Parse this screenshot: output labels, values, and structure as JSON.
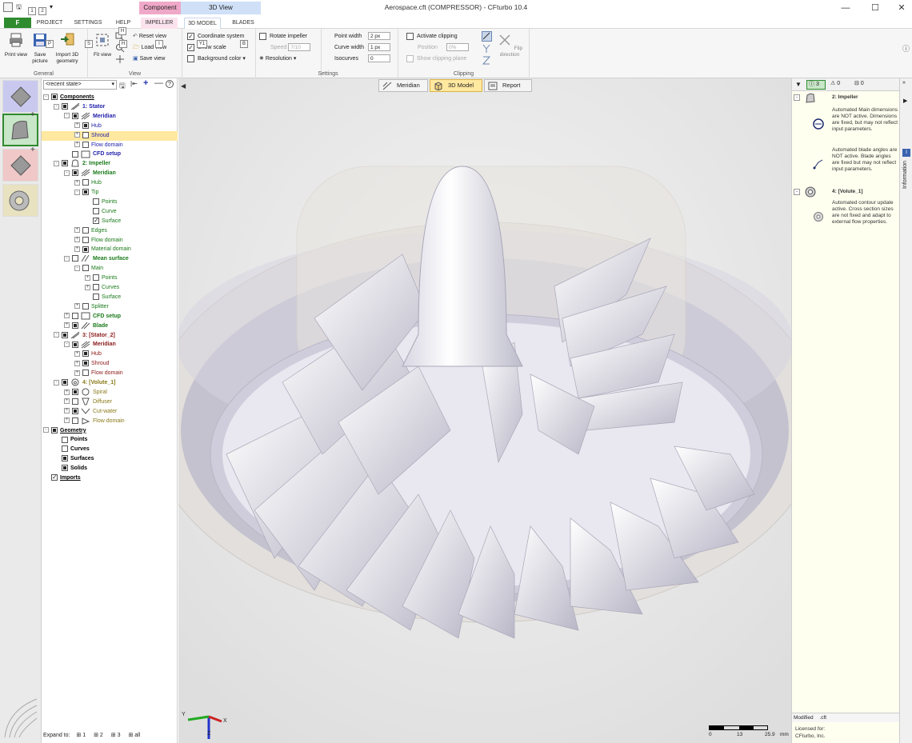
{
  "window": {
    "title": "Aerospace.cft (COMPRESSOR) - CFturbo 10.4",
    "minimize": "—",
    "maximize": "☐",
    "close": "✕"
  },
  "quick_access_keytips": [
    "1",
    "2"
  ],
  "context_tabs": {
    "component": "Component",
    "view3d": "3D View"
  },
  "tabs": [
    {
      "label": "F",
      "keytip": ""
    },
    {
      "label": "PROJECT",
      "keytip": "P"
    },
    {
      "label": "SETTINGS",
      "keytip": "S"
    },
    {
      "label": "HELP",
      "keytip": "H"
    },
    {
      "label": "IMPELLER",
      "keytip": "I"
    },
    {
      "label": "3D MODEL",
      "keytip": "Y1"
    },
    {
      "label": "BLADES",
      "keytip": "B"
    }
  ],
  "ribbon": {
    "general": {
      "label": "General",
      "print": "Print view",
      "save_picture": "Save picture",
      "import_3d": "Import 3D geometry"
    },
    "view": {
      "label": "View",
      "fit": "Fit view",
      "reset": "Reset view",
      "load": "Load view",
      "save": "Save view"
    },
    "display": {
      "coordinate_system": "Coordinate system",
      "show_scale": "Show scale",
      "background_color": "Background color"
    },
    "settings": {
      "label": "Settings",
      "rotate_impeller": "Rotate impeller",
      "speed_label": "Speed",
      "speed_value": "7/10",
      "resolution": "Resolution",
      "point_width_label": "Point width",
      "point_width_value": "2 px",
      "curve_width_label": "Curve width",
      "curve_width_value": "1 px",
      "isocurves_label": "Isocurves",
      "isocurves_value": "0"
    },
    "clipping": {
      "label": "Clipping",
      "activate": "Activate clipping",
      "position_label": "Position",
      "position_value": "0%",
      "show_plane": "Show clipping plane",
      "flip": "Flip direction"
    }
  },
  "tree": {
    "state_select": "<recent state>",
    "rows": [
      {
        "label": "Components",
        "indent": 0,
        "style": "bold-under",
        "color": "#000000",
        "pm": "-",
        "check": "on"
      },
      {
        "label": "1: Stator",
        "indent": 1,
        "style": "bold",
        "color": "#2222aa",
        "pm": "-",
        "check": "on",
        "icon": "stator"
      },
      {
        "label": "Meridian",
        "indent": 2,
        "style": "bold",
        "color": "#2222aa",
        "pm": "-",
        "check": "on",
        "icon": "meridian"
      },
      {
        "label": "Hub",
        "indent": 3,
        "style": "",
        "color": "#2222aa",
        "pm": "+",
        "check": "on"
      },
      {
        "label": "Shroud",
        "indent": 3,
        "style": "",
        "color": "#2222aa",
        "pm": "+",
        "check": "off",
        "selected": true
      },
      {
        "label": "Flow domain",
        "indent": 3,
        "style": "",
        "color": "#2222aa",
        "pm": "+",
        "check": "off"
      },
      {
        "label": "CFD setup",
        "indent": 2,
        "style": "bold",
        "color": "#2222aa",
        "pm": "",
        "check": "off",
        "icon": "cfd"
      },
      {
        "label": "2: Impeller",
        "indent": 1,
        "style": "bold",
        "color": "#1a7a1a",
        "pm": "-",
        "check": "on",
        "icon": "impeller"
      },
      {
        "label": "Meridian",
        "indent": 2,
        "style": "bold",
        "color": "#1a7a1a",
        "pm": "-",
        "check": "on",
        "icon": "meridian"
      },
      {
        "label": "Hub",
        "indent": 3,
        "style": "",
        "color": "#1a7a1a",
        "pm": "+",
        "check": "off"
      },
      {
        "label": "Tip",
        "indent": 3,
        "style": "",
        "color": "#1a7a1a",
        "pm": "-",
        "check": "on"
      },
      {
        "label": "Points",
        "indent": 4,
        "style": "",
        "color": "#1a7a1a",
        "pm": "",
        "check": "off"
      },
      {
        "label": "Curve",
        "indent": 4,
        "style": "",
        "color": "#1a7a1a",
        "pm": "",
        "check": "off"
      },
      {
        "label": "Surface",
        "indent": 4,
        "style": "",
        "color": "#1a7a1a",
        "pm": "",
        "check": "chk"
      },
      {
        "label": "Edges",
        "indent": 3,
        "style": "",
        "color": "#1a7a1a",
        "pm": "+",
        "check": "off"
      },
      {
        "label": "Flow domain",
        "indent": 3,
        "style": "",
        "color": "#1a7a1a",
        "pm": "+",
        "check": "off"
      },
      {
        "label": "Material domain",
        "indent": 3,
        "style": "",
        "color": "#1a7a1a",
        "pm": "+",
        "check": "on"
      },
      {
        "label": "Mean surface",
        "indent": 2,
        "style": "bold",
        "color": "#1a7a1a",
        "pm": "-",
        "check": "off",
        "icon": "mean"
      },
      {
        "label": "Main",
        "indent": 3,
        "style": "",
        "color": "#1a7a1a",
        "pm": "-",
        "check": "off"
      },
      {
        "label": "Points",
        "indent": 4,
        "style": "",
        "color": "#1a7a1a",
        "pm": "+",
        "check": "off"
      },
      {
        "label": "Curves",
        "indent": 4,
        "style": "",
        "color": "#1a7a1a",
        "pm": "+",
        "check": "off"
      },
      {
        "label": "Surface",
        "indent": 4,
        "style": "",
        "color": "#1a7a1a",
        "pm": "",
        "check": "off"
      },
      {
        "label": "Splitter",
        "indent": 3,
        "style": "",
        "color": "#1a7a1a",
        "pm": "+",
        "check": "off"
      },
      {
        "label": "CFD setup",
        "indent": 2,
        "style": "bold",
        "color": "#1a7a1a",
        "pm": "+",
        "check": "off",
        "icon": "cfd"
      },
      {
        "label": "Blade",
        "indent": 2,
        "style": "bold",
        "color": "#1a7a1a",
        "pm": "+",
        "check": "on",
        "icon": "blade"
      },
      {
        "label": "3: [Stator_2]",
        "indent": 1,
        "style": "bold",
        "color": "#8b1a1a",
        "pm": "-",
        "check": "on",
        "icon": "stator"
      },
      {
        "label": "Meridian",
        "indent": 2,
        "style": "bold",
        "color": "#8b1a1a",
        "pm": "-",
        "check": "on",
        "icon": "meridian"
      },
      {
        "label": "Hub",
        "indent": 3,
        "style": "",
        "color": "#8b1a1a",
        "pm": "+",
        "check": "on"
      },
      {
        "label": "Shroud",
        "indent": 3,
        "style": "",
        "color": "#8b1a1a",
        "pm": "+",
        "check": "on"
      },
      {
        "label": "Flow domain",
        "indent": 3,
        "style": "",
        "color": "#8b1a1a",
        "pm": "+",
        "check": "off"
      },
      {
        "label": "4: [Volute_1]",
        "indent": 1,
        "style": "bold",
        "color": "#8a7a1a",
        "pm": "-",
        "check": "on",
        "icon": "volute"
      },
      {
        "label": "Spiral",
        "indent": 2,
        "style": "",
        "color": "#8a7a1a",
        "pm": "+",
        "check": "on",
        "icon": "spiral"
      },
      {
        "label": "Diffuser",
        "indent": 2,
        "style": "",
        "color": "#8a7a1a",
        "pm": "+",
        "check": "off",
        "icon": "diffuser"
      },
      {
        "label": "Cut-water",
        "indent": 2,
        "style": "",
        "color": "#8a7a1a",
        "pm": "+",
        "check": "on",
        "icon": "cutwater"
      },
      {
        "label": "Flow domain",
        "indent": 2,
        "style": "",
        "color": "#8a7a1a",
        "pm": "+",
        "check": "off",
        "icon": "flow"
      },
      {
        "label": "Geometry",
        "indent": 0,
        "style": "bold-under",
        "color": "#000000",
        "pm": "-",
        "check": "on"
      },
      {
        "label": "Points",
        "indent": 1,
        "style": "bold",
        "color": "#000000",
        "pm": "",
        "check": "off"
      },
      {
        "label": "Curves",
        "indent": 1,
        "style": "bold",
        "color": "#000000",
        "pm": "",
        "check": "off"
      },
      {
        "label": "Surfaces",
        "indent": 1,
        "style": "bold",
        "color": "#000000",
        "pm": "",
        "check": "on"
      },
      {
        "label": "Solids",
        "indent": 1,
        "style": "bold",
        "color": "#000000",
        "pm": "",
        "check": "on"
      },
      {
        "label": "Imports",
        "indent": 0,
        "style": "bold-under",
        "color": "#000000",
        "pm": "",
        "check": "chk"
      }
    ],
    "expand": {
      "label": "Expand to:",
      "l1": "1",
      "l2": "2",
      "l3": "3",
      "all": "all"
    }
  },
  "view_tabs": {
    "meridian": "Meridian",
    "model": "3D Model",
    "report": "Report"
  },
  "scale": {
    "min": "0",
    "mid": "13",
    "max": "25.9",
    "unit": "mm"
  },
  "axes": {
    "x": "X",
    "y": "Y",
    "z": "Z"
  },
  "info": {
    "filter_count": "3",
    "warning_count": "0",
    "error_count": "0",
    "impeller_title": "2: Impeller",
    "impeller_msg1": "Automated Main dimensions are NOT active. Dimensions are fixed, but may not reflect input parameters.",
    "impeller_msg2": "Automated blade angles are NOT active. Blade angles are fixed but may not reflect input parameters.",
    "volute_title": "4: [Volute_1]",
    "volute_msg": "Automated contour update active. Cross section sizes are not fixed and adapt to external flow properties.",
    "modified_label": "Modified",
    "modified_value": ".cft",
    "licensed_label": "Licensed for:",
    "licensed_value": "CFturbo, Inc."
  },
  "side_panel_label": "Information",
  "colors": {
    "component_tab": "#f0a8c8",
    "view3d_tab": "#cfe0f7",
    "selected_row": "#ffe8a0",
    "stator": "#2222aa",
    "impeller": "#1a7a1a",
    "stator2": "#8b1a1a",
    "volute": "#8a7a1a"
  }
}
